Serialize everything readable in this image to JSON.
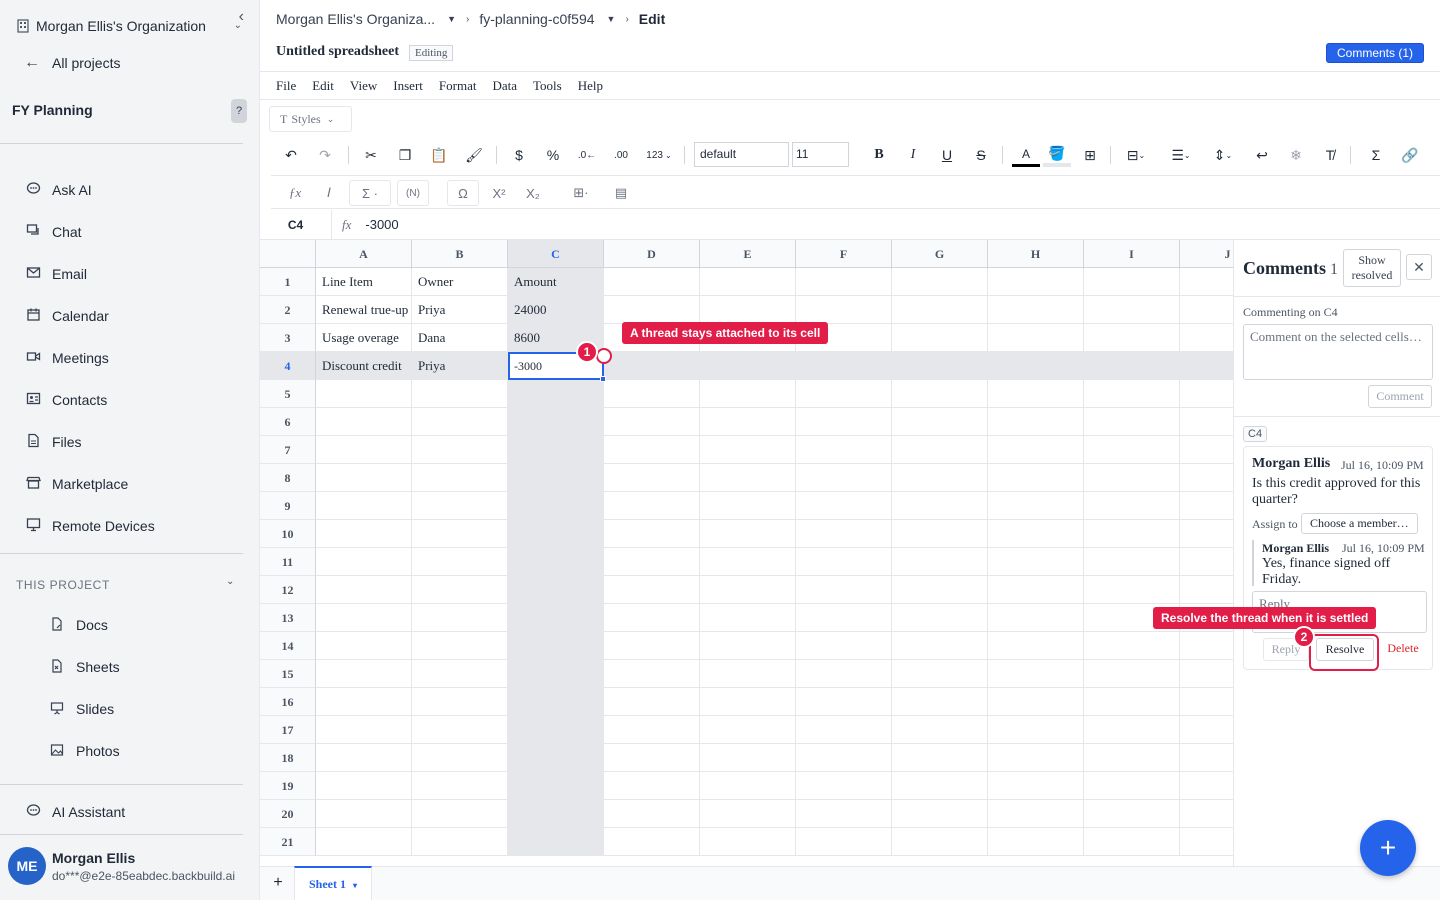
{
  "sidebar": {
    "org_name": "Morgan Ellis's Organization",
    "all_projects": "All projects",
    "project_name": "FY Planning",
    "help": "?",
    "nav": [
      {
        "label": "Ask AI",
        "icon": "chat-bubble-icon"
      },
      {
        "label": "Chat",
        "icon": "chat-icon"
      },
      {
        "label": "Email",
        "icon": "mail-icon"
      },
      {
        "label": "Calendar",
        "icon": "calendar-icon"
      },
      {
        "label": "Meetings",
        "icon": "video-icon"
      },
      {
        "label": "Contacts",
        "icon": "contacts-icon"
      },
      {
        "label": "Files",
        "icon": "file-icon"
      },
      {
        "label": "Marketplace",
        "icon": "store-icon"
      },
      {
        "label": "Remote Devices",
        "icon": "monitor-icon"
      }
    ],
    "section_title": "THIS PROJECT",
    "project_items": [
      {
        "label": "Docs",
        "icon": "doc-icon"
      },
      {
        "label": "Sheets",
        "icon": "sheet-icon"
      },
      {
        "label": "Slides",
        "icon": "slides-icon"
      },
      {
        "label": "Photos",
        "icon": "photo-icon"
      }
    ],
    "ai_assistant": "AI Assistant",
    "user": {
      "initials": "ME",
      "name": "Morgan Ellis",
      "email": "do***@e2e-85eabdec.backbuild.ai"
    }
  },
  "header": {
    "crumb_org": "Morgan Ellis's Organiza...",
    "crumb_project": "fy-planning-c0f594",
    "crumb_current": "Edit",
    "doc_title": "Untitled spreadsheet",
    "status": "Editing",
    "comments_button": "Comments (1)"
  },
  "menu": [
    "File",
    "Edit",
    "View",
    "Insert",
    "Format",
    "Data",
    "Tools",
    "Help"
  ],
  "toolbar": {
    "styles": "Styles",
    "font": "default",
    "font_size": "11",
    "number_format": "123"
  },
  "formula_bar": {
    "cell": "C4",
    "fx": "fx",
    "value": "-3000"
  },
  "grid": {
    "columns": [
      "A",
      "B",
      "C",
      "D",
      "E",
      "F",
      "G",
      "H",
      "I",
      "J"
    ],
    "rows": [
      "1",
      "2",
      "3",
      "4",
      "5",
      "6",
      "7",
      "8",
      "9",
      "10",
      "11",
      "12",
      "13",
      "14",
      "15",
      "16",
      "17",
      "18",
      "19",
      "20",
      "21"
    ],
    "cells": [
      [
        "Line Item",
        "Owner",
        "Amount"
      ],
      [
        "Renewal true-up",
        "Priya",
        "24000"
      ],
      [
        "Usage overage",
        "Dana",
        "8600"
      ],
      [
        "Discount credit",
        "Priya",
        "-3000"
      ]
    ],
    "selected_column": "C",
    "selected_row": "4"
  },
  "callouts": {
    "one_text": "A thread stays attached to its cell",
    "one_num": "1",
    "two_text": "Resolve the thread when it is settled",
    "two_num": "2"
  },
  "comments_panel": {
    "title": "Comments",
    "count": "1",
    "show_resolved": "Show resolved",
    "commenting_on": "Commenting on C4",
    "placeholder": "Comment on the selected cells…",
    "comment_button": "Comment",
    "thread_cell": "C4",
    "thread": {
      "author": "Morgan Ellis",
      "time": "Jul 16, 10:09 PM",
      "body": "Is this credit approved for this quarter?",
      "assign_label": "Assign to",
      "assign_placeholder": "Choose a member…",
      "reply_author": "Morgan Ellis",
      "reply_time": "Jul 16, 10:09 PM",
      "reply_body": "Yes, finance signed off Friday.",
      "reply_placeholder": "Reply",
      "reply_button": "Reply",
      "resolve_button": "Resolve",
      "delete_button": "Delete"
    }
  },
  "sheets": {
    "add": "+",
    "active": "Sheet 1"
  },
  "colors": {
    "accent": "#2563eb",
    "callout": "#e11d48",
    "danger": "#dc2626"
  }
}
